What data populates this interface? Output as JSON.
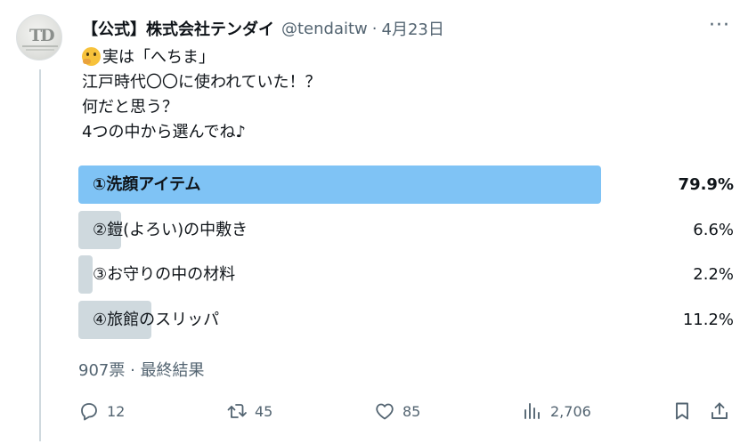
{
  "tweet": {
    "display_name": "【公式】株式会社テンダイ",
    "handle": "@tendaitw",
    "separator": "·",
    "date": "4月23日",
    "more_label": "···",
    "emoji_name": "thinking-face",
    "lines": [
      "実は「へちま」",
      "江戸時代〇〇に使われていた！？",
      "何だと思う？",
      "4つの中から選んでね♪"
    ]
  },
  "poll": {
    "options": [
      {
        "label": "①洗顔アイテム",
        "percent_text": "79.9%",
        "percent": 79.9,
        "winner": true
      },
      {
        "label": "②鎧(よろい)の中敷き",
        "percent_text": "6.6%",
        "percent": 6.6,
        "winner": false
      },
      {
        "label": "③お守りの中の材料",
        "percent_text": "2.2%",
        "percent": 2.2,
        "winner": false
      },
      {
        "label": "④旅館のスリッパ",
        "percent_text": "11.2%",
        "percent": 11.2,
        "winner": false
      }
    ],
    "votes": "907票",
    "separator": "·",
    "status": "最終結果"
  },
  "actions": {
    "reply_count": "12",
    "retweet_count": "45",
    "like_count": "85",
    "view_count": "2,706"
  },
  "colors": {
    "winner_bar": "#7fc3f5",
    "bar": "#cfd9de",
    "muted_text": "#536471"
  }
}
